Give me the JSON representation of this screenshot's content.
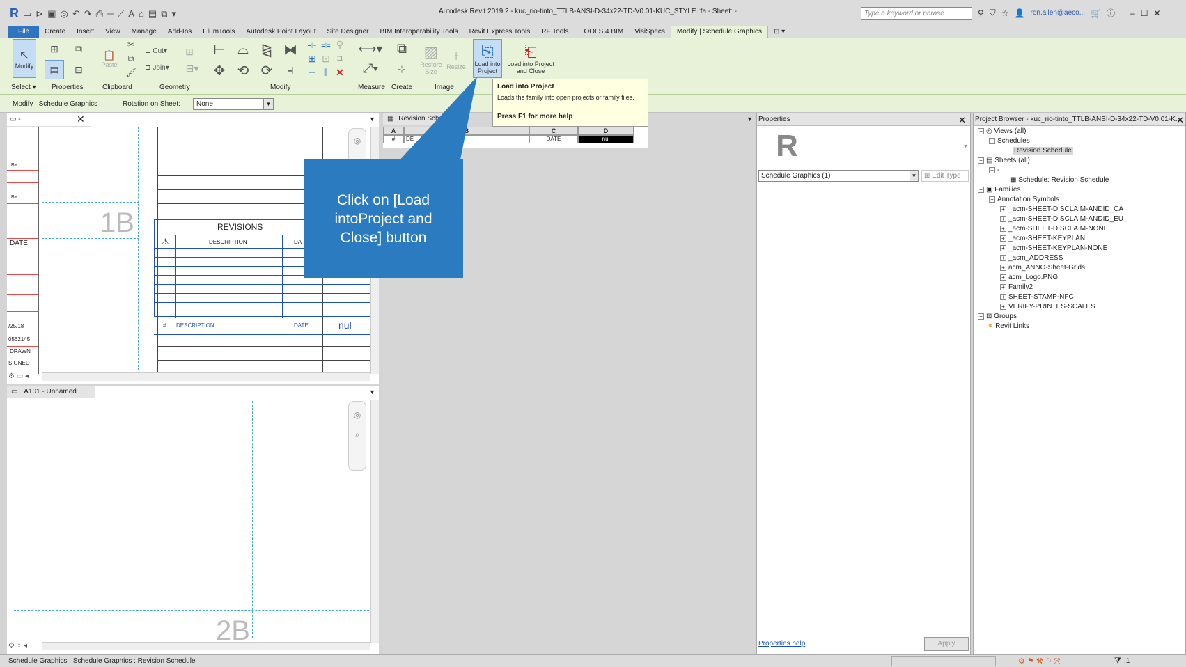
{
  "titlebar": {
    "app_logo": "R",
    "title": "Autodesk Revit 2019.2 - kuc_rio-tinto_TTLB-ANSI-D-34x22-TD-V0.01-KUC_STYLE.rfa - Sheet: -",
    "search_placeholder": "Type a keyword or phrase",
    "user": "ron.allen@aeco...",
    "minimize": "–",
    "maximize": "☐",
    "close": "✕"
  },
  "tabs": [
    "File",
    "Create",
    "Insert",
    "View",
    "Manage",
    "Add-Ins",
    "ElumTools",
    "Autodesk Point Layout",
    "Site Designer",
    "BIM Interoperability Tools",
    "Revit Express Tools",
    "RF Tools",
    "TOOLS 4 BIM",
    "VisiSpecs",
    "Modify | Schedule Graphics"
  ],
  "ribbon": {
    "modify_label": "Modify",
    "cut_label": "Cut",
    "join_label": "Join",
    "paste_label": "Paste",
    "restore_size": "Restore Size",
    "resize": "Resize",
    "load_into_project": "Load into Project",
    "load_into_project_close": "Load into Project and Close",
    "groups": {
      "select": "Select",
      "properties": "Properties",
      "clipboard": "Clipboard",
      "geometry": "Geometry",
      "modify": "Modify",
      "measure": "Measure",
      "create": "Create",
      "image": "Image"
    }
  },
  "tooltip": {
    "title": "Load into Project",
    "desc": "Loads the family into open projects or family files.",
    "help": "Press F1 for more help"
  },
  "optionsbar": {
    "context": "Modify | Schedule Graphics",
    "rotation_label": "Rotation on Sheet:",
    "rotation_value": "None"
  },
  "callout": {
    "text": "Click on [Load intoProject and Close] button"
  },
  "view_top": {
    "tab_label": "-",
    "grid_1b": "1B",
    "revisions": "REVISIONS",
    "description": "DESCRIPTION",
    "date_partial": "DA",
    "date_label": "DATE",
    "sched_hash": "#",
    "sched_desc": "DESCRIPTION",
    "sched_date": "DATE",
    "sched_nul": "nul",
    "left_by1": "BY",
    "left_by2": "BY",
    "left_date": "DATE",
    "left_d1": "/25/18",
    "left_d2": "0562145",
    "left_drawn": "DRAWN",
    "left_signed": "SIGNED"
  },
  "view_bottom": {
    "tab_label": "A101 - Unnamed",
    "grid_2b": "2B"
  },
  "schedule_view": {
    "tab_label": "Revision Sch",
    "cols": [
      "A",
      "B",
      "C",
      "D"
    ],
    "row": [
      "#",
      "DE",
      "N",
      "DATE",
      "nul"
    ]
  },
  "properties": {
    "title": "Properties",
    "type_selector": "Schedule Graphics (1)",
    "edit_type": "Edit Type",
    "help": "Properties help",
    "apply": "Apply"
  },
  "project_browser": {
    "title": "Project Browser - kuc_rio-tinto_TTLB-ANSI-D-34x22-TD-V0.01-K...",
    "views_all": "Views (all)",
    "schedules": "Schedules",
    "revision_schedule": "Revision Schedule",
    "sheets_all": "Sheets (all)",
    "sheet_dash": "-",
    "schedule_revision": "Schedule: Revision Schedule",
    "families": "Families",
    "annotation_symbols": "Annotation Symbols",
    "symbols": [
      "_acm-SHEET-DISCLAIM-ANDID_CA",
      "_acm-SHEET-DISCLAIM-ANDID_EU",
      "_acm-SHEET-DISCLAIM-NONE",
      "_acm-SHEET-KEYPLAN",
      "_acm-SHEET-KEYPLAN-NONE",
      "_acm_ADDRESS",
      "acm_ANNO-Sheet-Grids",
      "acm_Logo.PNG",
      "Family2",
      "SHEET-STAMP-NFC",
      "VERIFY-PRINTES-SCALES"
    ],
    "groups": "Groups",
    "revit_links": "Revit Links"
  },
  "statusbar": {
    "text": "Schedule Graphics : Schedule Graphics : Revision Schedule",
    "filter_count": ":1"
  }
}
